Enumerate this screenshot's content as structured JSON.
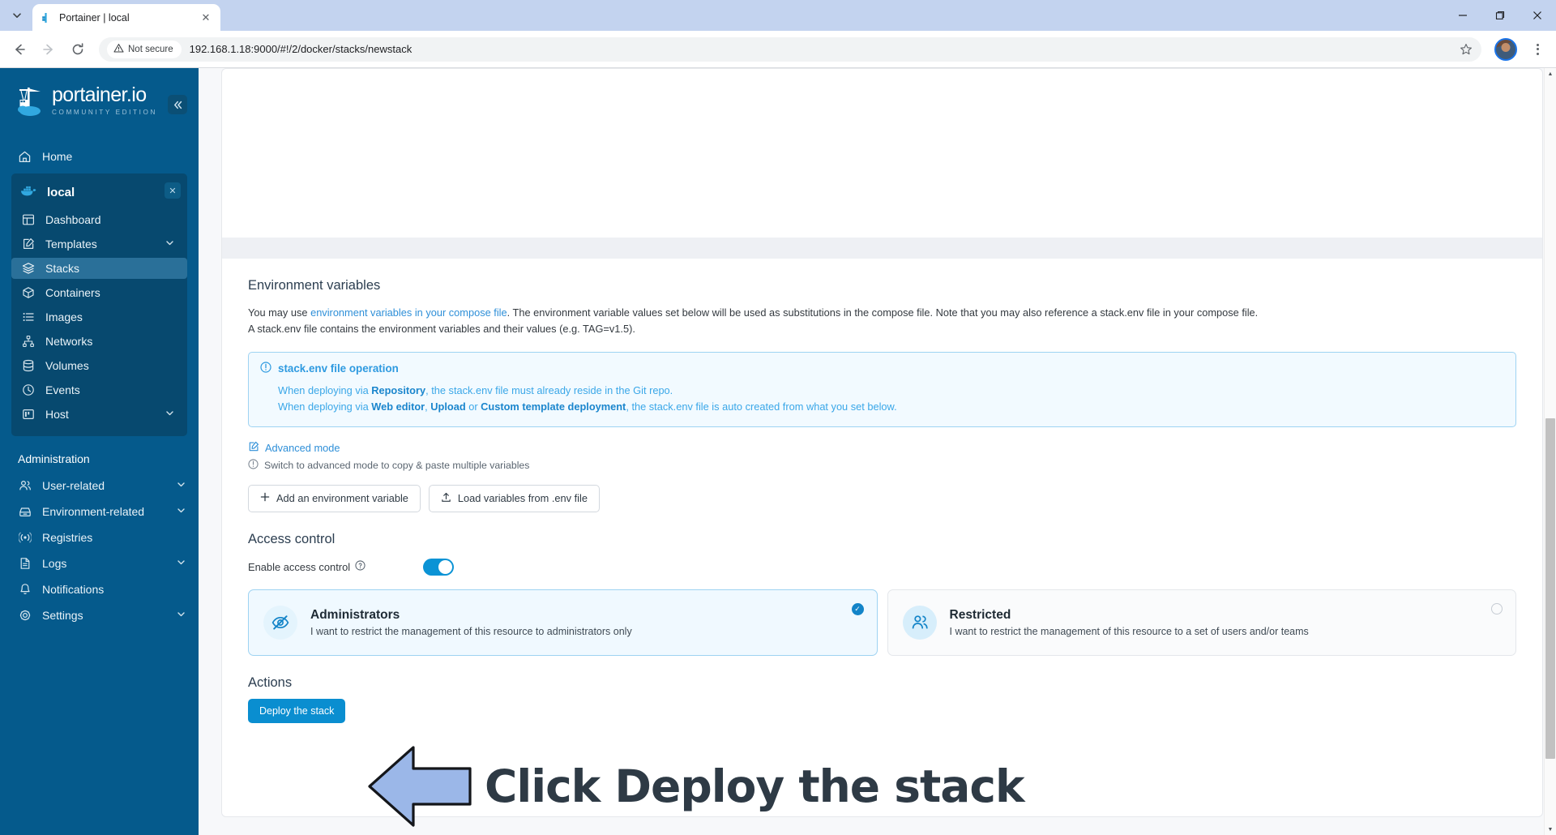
{
  "browser": {
    "tab": {
      "title": "Portainer | local",
      "favicon_icon": "portainer-favicon",
      "close_icon": "close-icon"
    },
    "tab_list_icon": "chevron-down-icon",
    "window": {
      "minimize_icon": "minimize-icon",
      "maximize_icon": "maximize-icon",
      "close_icon": "window-close-icon"
    },
    "toolbar": {
      "back_icon": "arrow-left-icon",
      "forward_icon": "arrow-right-icon",
      "reload_icon": "reload-icon",
      "security_label": "Not secure",
      "security_icon": "warning-triangle-icon",
      "url": "192.168.1.18:9000/#!/2/docker/stacks/newstack",
      "bookmark_icon": "star-icon",
      "profile_icon": "avatar",
      "menu_icon": "three-dots-icon"
    }
  },
  "sidebar": {
    "logo_text": "portainer.io",
    "logo_sub": "COMMUNITY EDITION",
    "collapse_icon": "chevrons-left-icon",
    "home": {
      "label": "Home",
      "icon": "home-icon"
    },
    "environment": {
      "name": "local",
      "icon": "docker-icon",
      "close_icon": "close-icon",
      "items": [
        {
          "label": "Dashboard",
          "icon": "dashboard-icon",
          "chevron": "",
          "active": false
        },
        {
          "label": "Templates",
          "icon": "templates-icon",
          "chevron": "⌄",
          "active": false
        },
        {
          "label": "Stacks",
          "icon": "stacks-icon",
          "chevron": "",
          "active": true
        },
        {
          "label": "Containers",
          "icon": "containers-icon",
          "chevron": "",
          "active": false
        },
        {
          "label": "Images",
          "icon": "images-icon",
          "chevron": "",
          "active": false
        },
        {
          "label": "Networks",
          "icon": "networks-icon",
          "chevron": "",
          "active": false
        },
        {
          "label": "Volumes",
          "icon": "volumes-icon",
          "chevron": "",
          "active": false
        },
        {
          "label": "Events",
          "icon": "events-icon",
          "chevron": "",
          "active": false
        },
        {
          "label": "Host",
          "icon": "host-icon",
          "chevron": "⌄",
          "active": false
        }
      ]
    },
    "administration_title": "Administration",
    "admin_items": [
      {
        "label": "User-related",
        "icon": "users-icon",
        "chevron": "⌄"
      },
      {
        "label": "Environment-related",
        "icon": "environment-icon",
        "chevron": "⌄"
      },
      {
        "label": "Registries",
        "icon": "registries-icon",
        "chevron": ""
      },
      {
        "label": "Logs",
        "icon": "logs-icon",
        "chevron": "⌄"
      },
      {
        "label": "Notifications",
        "icon": "bell-icon",
        "chevron": ""
      },
      {
        "label": "Settings",
        "icon": "gear-icon",
        "chevron": "⌄"
      }
    ]
  },
  "main": {
    "env_vars": {
      "heading": "Environment variables",
      "desc_part1": "You may use ",
      "desc_link": "environment variables in your compose file",
      "desc_part2": ". The environment variable values set below will be used as substitutions in the compose file. Note that you may also reference a stack.env file in your compose file. A stack.env file contains the environment variables and their values (e.g. TAG=v1.5).",
      "infobox": {
        "icon": "info-circle-icon",
        "title": "stack.env file operation",
        "line1_a": "When deploying via ",
        "line1_b": "Repository",
        "line1_c": ", the stack.env file must already reside in the Git repo.",
        "line2_a": "When deploying via ",
        "line2_b": "Web editor",
        "line2_c": ", ",
        "line2_d": "Upload",
        "line2_e": " or ",
        "line2_f": "Custom template deployment",
        "line2_g": ", the stack.env file is auto created from what you set below."
      },
      "advanced_mode_label": "Advanced mode",
      "advanced_mode_icon": "edit-square-icon",
      "advanced_hint": "Switch to advanced mode to copy & paste multiple variables",
      "advanced_hint_icon": "info-circle-icon",
      "add_var_button": "Add an environment variable",
      "add_var_icon": "plus-icon",
      "load_env_button": "Load variables from .env file",
      "load_env_icon": "upload-icon"
    },
    "access_control": {
      "heading": "Access control",
      "toggle_label": "Enable access control",
      "toggle_help_icon": "question-circle-icon",
      "toggle_on": true,
      "options": [
        {
          "title": "Administrators",
          "subtitle": "I want to restrict the management of this resource to administrators only",
          "icon": "eye-off-icon",
          "selected": true
        },
        {
          "title": "Restricted",
          "subtitle": "I want to restrict the management of this resource to a set of users and/or teams",
          "icon": "users-icon",
          "selected": false
        }
      ]
    },
    "actions": {
      "heading": "Actions",
      "deploy_button": "Deploy the stack"
    }
  },
  "annotation": {
    "text": "Click Deploy the stack",
    "arrow_icon": "left-arrow-annotation",
    "arrow_fill": "#9bb7e8",
    "text_color": "#2e3a45"
  },
  "colors": {
    "sidebar_bg": "#055a8c",
    "accent_blue": "#0a8ed0",
    "info_blue": "#2e9ae0",
    "active_nav": "#2a7099"
  },
  "scrollbar": {
    "up_icon": "caret-up-icon",
    "down_icon": "caret-down-icon"
  }
}
